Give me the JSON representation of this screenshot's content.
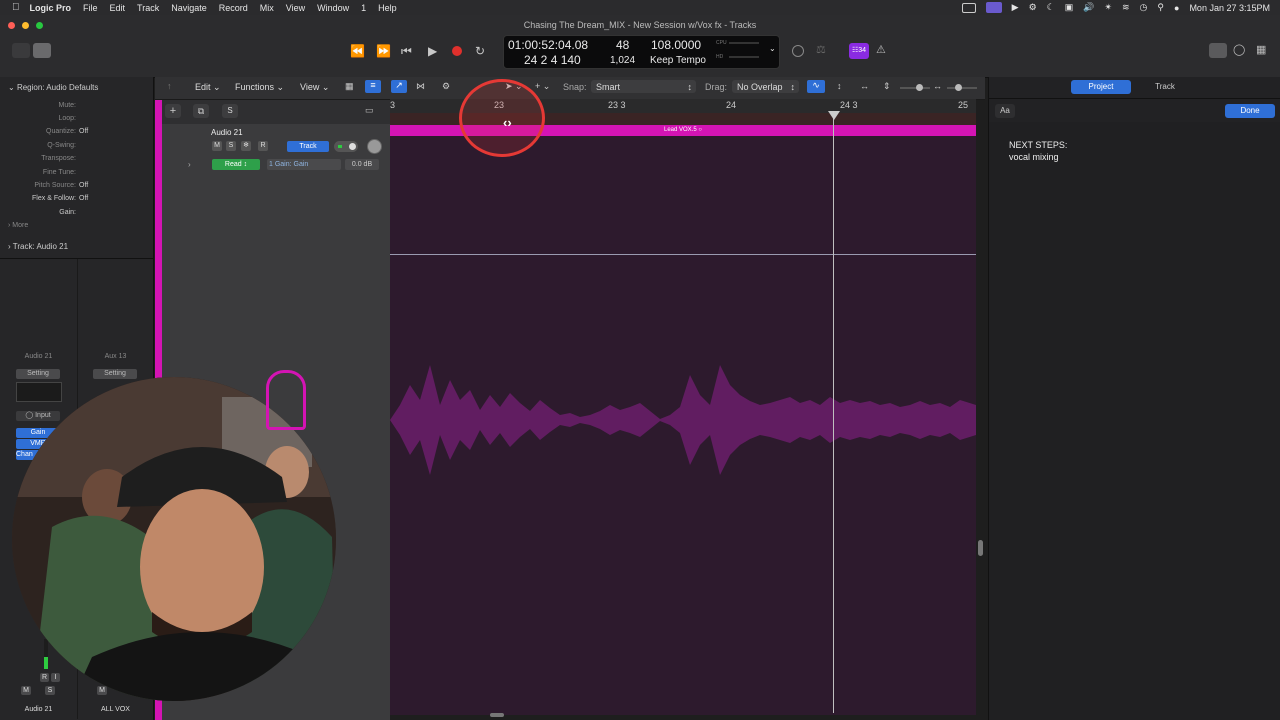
{
  "menubar": {
    "apple": "",
    "app_name": "Logic Pro",
    "items": [
      "File",
      "Edit",
      "Track",
      "Navigate",
      "Record",
      "Mix",
      "View",
      "Window",
      "1",
      "Help"
    ],
    "datetime": "Mon Jan 27  3:15PM"
  },
  "window": {
    "title": "Chasing The Dream_MIX - New Session w/Vox fx - Tracks"
  },
  "lcd": {
    "time": "01:00:52:04.08",
    "bars": "24  2  4  140",
    "tempo_top": "48",
    "sub": "1,024",
    "bpm": "108.0000",
    "tempo_mode": "Keep Tempo",
    "cpu_label": "CPU",
    "hd_label": "HD"
  },
  "toolbar": {
    "badge": "☷34"
  },
  "inspector": {
    "region_title": "Region: Audio Defaults",
    "rows": [
      {
        "k": "Mute:",
        "v": ""
      },
      {
        "k": "Loop:",
        "v": ""
      },
      {
        "k": "Quantize:",
        "v": "Off"
      },
      {
        "k": "Q-Swing:",
        "v": ""
      },
      {
        "k": "Transpose:",
        "v": ""
      },
      {
        "k": "Fine Tune:",
        "v": ""
      },
      {
        "k": "Pitch Source:",
        "v": "Off"
      },
      {
        "k": "Flex & Follow:",
        "v": "Off"
      },
      {
        "k": "Gain:",
        "v": ""
      }
    ],
    "more": "More",
    "track_title": "Track:  Audio 21",
    "strip1_name": "Audio 21",
    "strip2_name": "Aux 13",
    "setting": "Setting",
    "input": "Input",
    "gain_slot": "Gain",
    "vmr_slot": "VMR",
    "chan_slot": "Chan",
    "strip1_footer": "Audio 21",
    "strip2_footer": "ALL VOX",
    "m": "M",
    "s": "S",
    "r": "R",
    "i": "I"
  },
  "arrange_toolbar": {
    "edit": "Edit",
    "functions": "Functions",
    "view": "View",
    "snap_label": "Snap:",
    "snap_value": "Smart",
    "drag_label": "Drag:",
    "drag_value": "No Overlap"
  },
  "track_header": {
    "name": "Audio 21",
    "m": "M",
    "s": "S",
    "r": "R",
    "track_btn": "Track",
    "automation_mode": "Read",
    "automation_param": "1 Gain: Gain",
    "automation_value": "0.0 dB",
    "s_btn": "S"
  },
  "ruler": {
    "ticks": [
      "3",
      "23",
      "23 3",
      "24",
      "24 3",
      "25"
    ]
  },
  "region": {
    "name": "Lead VOX.5"
  },
  "right_panel": {
    "tab_project": "Project",
    "tab_track": "Track",
    "font_btn": "Aa",
    "done": "Done",
    "notes_line1": "NEXT STEPS:",
    "notes_line2": "vocal mixing"
  },
  "colors": {
    "region": "#d414b4",
    "lane_bg": "#2d1a2d",
    "accent_blue": "#2f6fd6",
    "record_red": "#e0302c",
    "highlight_red": "#e53935"
  }
}
